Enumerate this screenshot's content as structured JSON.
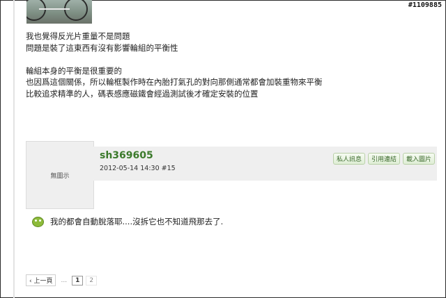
{
  "watermark": "#1109885",
  "post": {
    "lines": [
      "我也覺得反光片重量不是問題",
      "問題是裝了這東西有沒有影響輪組的平衡性",
      "",
      "輪組本身的平衡是很重要的",
      "也因爲這個關係，所以輪框製作時在內胎打氣孔的對向那側通常都會加裝重物來平衡",
      "比較追求精準的人，碼表感應磁鐵會經過測試後才確定安裝的位置"
    ]
  },
  "reply": {
    "avatar_text": "無圖示",
    "username": "sh369605",
    "meta": "2012-05-14 14:30  #15",
    "actions": [
      "私人訊息",
      "引用連結",
      "載入圖片"
    ],
    "body": "我的都會自動脫落耶....沒拆它也不知道飛那去了."
  },
  "pager": {
    "prev": "‹ 上一頁",
    "ellipsis": "...",
    "pages": [
      "1",
      "2"
    ],
    "current": "1"
  },
  "icons": {
    "reply_emoticon": "smiley-icon"
  }
}
